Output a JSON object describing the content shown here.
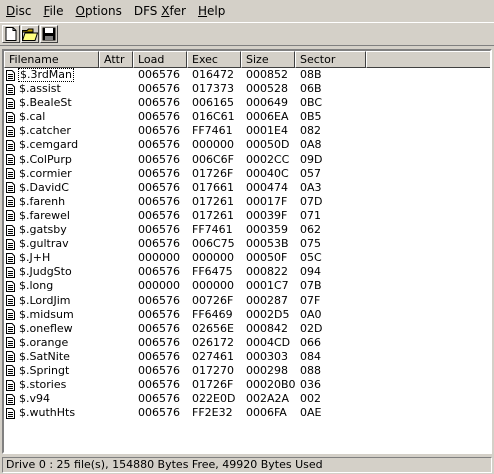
{
  "menu": {
    "disc": {
      "key": "D",
      "rest": "isc"
    },
    "file": {
      "key": "F",
      "rest": "ile"
    },
    "options": {
      "key": "O",
      "rest": "ptions"
    },
    "dfs_xfer": {
      "before": "DFS ",
      "key": "X",
      "rest": "fer"
    },
    "help": {
      "key": "H",
      "rest": "elp"
    }
  },
  "toolbar": {
    "icons": [
      "new-icon",
      "open-folder-icon",
      "save-icon"
    ]
  },
  "columns": {
    "filename": "Filename",
    "attr": "Attr",
    "load": "Load",
    "exec": "Exec",
    "size": "Size",
    "sector": "Sector"
  },
  "files": [
    {
      "name": "$.3rdMan",
      "attr": "",
      "load": "006576",
      "exec": "016472",
      "size": "000852",
      "sector": "08B",
      "selected": true
    },
    {
      "name": "$.assist",
      "attr": "",
      "load": "006576",
      "exec": "017373",
      "size": "000528",
      "sector": "06B"
    },
    {
      "name": "$.BealeSt",
      "attr": "",
      "load": "006576",
      "exec": "006165",
      "size": "000649",
      "sector": "0BC"
    },
    {
      "name": "$.cal",
      "attr": "",
      "load": "006576",
      "exec": "016C61",
      "size": "0006EA",
      "sector": "0B5"
    },
    {
      "name": "$.catcher",
      "attr": "",
      "load": "006576",
      "exec": "FF7461",
      "size": "0001E4",
      "sector": "082"
    },
    {
      "name": "$.cemgard",
      "attr": "",
      "load": "006576",
      "exec": "000000",
      "size": "00050D",
      "sector": "0A8"
    },
    {
      "name": "$.ColPurp",
      "attr": "",
      "load": "006576",
      "exec": "006C6F",
      "size": "0002CC",
      "sector": "09D"
    },
    {
      "name": "$.cormier",
      "attr": "",
      "load": "006576",
      "exec": "01726F",
      "size": "00040C",
      "sector": "057"
    },
    {
      "name": "$.DavidC",
      "attr": "",
      "load": "006576",
      "exec": "017661",
      "size": "000474",
      "sector": "0A3"
    },
    {
      "name": "$.farenh",
      "attr": "",
      "load": "006576",
      "exec": "017261",
      "size": "00017F",
      "sector": "07D"
    },
    {
      "name": "$.farewel",
      "attr": "",
      "load": "006576",
      "exec": "017261",
      "size": "00039F",
      "sector": "071"
    },
    {
      "name": "$.gatsby",
      "attr": "",
      "load": "006576",
      "exec": "FF7461",
      "size": "000359",
      "sector": "062"
    },
    {
      "name": "$.gultrav",
      "attr": "",
      "load": "006576",
      "exec": "006C75",
      "size": "00053B",
      "sector": "075"
    },
    {
      "name": "$.J+H",
      "attr": "",
      "load": "000000",
      "exec": "000000",
      "size": "00050F",
      "sector": "05C"
    },
    {
      "name": "$.JudgSto",
      "attr": "",
      "load": "006576",
      "exec": "FF6475",
      "size": "000822",
      "sector": "094"
    },
    {
      "name": "$.long",
      "attr": "",
      "load": "000000",
      "exec": "000000",
      "size": "0001C7",
      "sector": "07B"
    },
    {
      "name": "$.LordJim",
      "attr": "",
      "load": "006576",
      "exec": "00726F",
      "size": "000287",
      "sector": "07F"
    },
    {
      "name": "$.midsum",
      "attr": "",
      "load": "006576",
      "exec": "FF6469",
      "size": "0002D5",
      "sector": "0A0"
    },
    {
      "name": "$.oneflew",
      "attr": "",
      "load": "006576",
      "exec": "02656E",
      "size": "000842",
      "sector": "02D"
    },
    {
      "name": "$.orange",
      "attr": "",
      "load": "006576",
      "exec": "026172",
      "size": "0004CD",
      "sector": "066"
    },
    {
      "name": "$.SatNite",
      "attr": "",
      "load": "006576",
      "exec": "027461",
      "size": "000303",
      "sector": "084"
    },
    {
      "name": "$.Springt",
      "attr": "",
      "load": "006576",
      "exec": "017270",
      "size": "000298",
      "sector": "088"
    },
    {
      "name": "$.stories",
      "attr": "",
      "load": "006576",
      "exec": "01726F",
      "size": "00020B0",
      "sector": "036"
    },
    {
      "name": "$.v94",
      "attr": "",
      "load": "006576",
      "exec": "022E0D",
      "size": "002A2A",
      "sector": "002"
    },
    {
      "name": "$.wuthHts",
      "attr": "",
      "load": "006576",
      "exec": "FF2E32",
      "size": "0006FA",
      "sector": "0AE"
    }
  ],
  "status": "Drive 0 : 25 file(s),  154880 Bytes Free,  49920 Bytes Used",
  "colors": {
    "face": "#d4d0c8",
    "list_bg": "#ffffff",
    "highlight_shadow": "#808080"
  }
}
